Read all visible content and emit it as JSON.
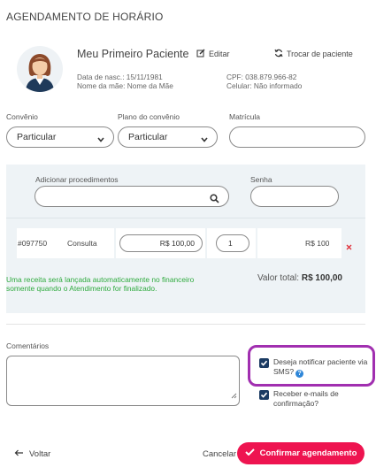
{
  "page": {
    "title": "AGENDAMENTO DE HORÁRIO"
  },
  "patient": {
    "name": "Meu Primeiro Paciente",
    "edit_label": "Editar",
    "swap_label": "Trocar de paciente",
    "birth": "Data de nasc.: 15/11/1981",
    "mother": "Nome da mãe: Nome da Mãe",
    "cpf": "CPF: 038.879.966-82",
    "phone": "Celular: Não informado"
  },
  "form": {
    "convenio_label": "Convênio",
    "convenio_value": "Particular",
    "plano_label": "Plano do convênio",
    "plano_value": "Particular",
    "matricula_label": "Matrícula",
    "matricula_value": ""
  },
  "procedures": {
    "add_label": "Adicionar procedimentos",
    "senha_label": "Senha",
    "rows": [
      {
        "code": "#097750",
        "name": "Consulta",
        "price": "R$ 100,00",
        "qty": "1",
        "total": "R$ 100"
      }
    ],
    "note": "Uma receita será lançada automaticamente no financeiro somente quando o Atendimento for finalizado.",
    "total_label": "Valor total:",
    "total_value": "R$ 100,00"
  },
  "comments": {
    "label": "Comentários",
    "value": ""
  },
  "options": {
    "sms_label": "Deseja notificar paciente via SMS?",
    "sms_checked": true,
    "email_label": "Receber e-mails de confirmação?",
    "email_checked": true
  },
  "footer": {
    "back_label": "Voltar",
    "cancel_label": "Cancelar",
    "confirm_label": "Confirmar agendamento"
  },
  "colors": {
    "accent": "#ee1450",
    "checkbox": "#1b3b63",
    "note_green": "#2eaa3e",
    "highlight": "#a12fb0",
    "help": "#2e86d8",
    "delete": "#e0303a"
  }
}
